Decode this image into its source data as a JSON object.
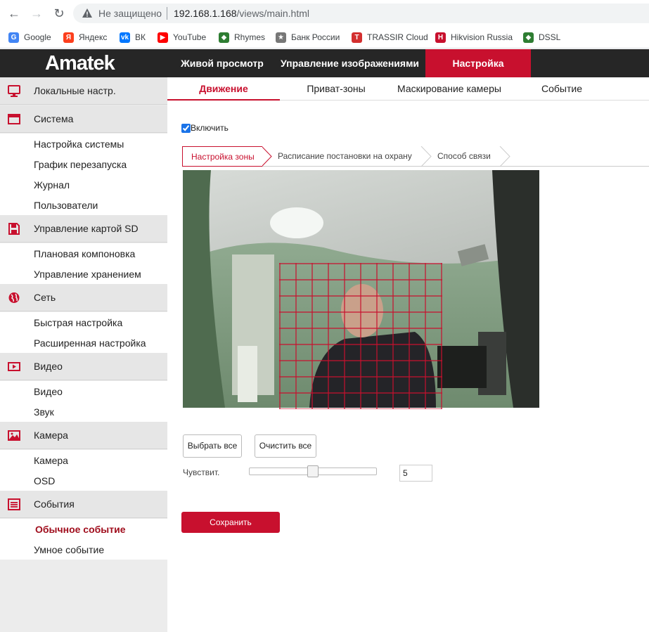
{
  "browser": {
    "security_label": "Не защищено",
    "url_host": "192.168.1.168",
    "url_path": "/views/main.html",
    "bookmarks": [
      {
        "label": "Google",
        "icon": "google-icon",
        "color": "#4285f4"
      },
      {
        "label": "Яндекс",
        "icon": "yandex-icon",
        "color": "#fc3f1d"
      },
      {
        "label": "ВК",
        "icon": "vk-icon",
        "color": "#0077ff"
      },
      {
        "label": "YouTube",
        "icon": "youtube-icon",
        "color": "#ff0000"
      },
      {
        "label": "Rhymes",
        "icon": "rhymes-icon",
        "color": "#2e7d32"
      },
      {
        "label": "Банк России",
        "icon": "bank-russia-icon",
        "color": "#777777"
      },
      {
        "label": "TRASSIR Cloud",
        "icon": "trassir-icon",
        "color": "#d32f2f"
      },
      {
        "label": "Hikvision Russia",
        "icon": "hikvision-icon",
        "color": "#c8102e"
      },
      {
        "label": "DSSL",
        "icon": "dssl-icon",
        "color": "#2e7d32"
      }
    ]
  },
  "app": {
    "logo": "Amatek",
    "top_nav": [
      "Живой просмотр",
      "Управление изображениями",
      "Настройка"
    ],
    "active_top_nav": "Настройка",
    "accent": "#c8102e"
  },
  "sidebar": {
    "sections": [
      {
        "label": "Локальные настр.",
        "icon": "monitor-icon",
        "items": []
      },
      {
        "label": "Система",
        "icon": "window-icon",
        "items": [
          "Настройка системы",
          "График перезапуска",
          "Журнал",
          "Пользователи"
        ]
      },
      {
        "label": "Управление картой SD",
        "icon": "sd-card-icon",
        "items": [
          "Плановая компоновка",
          "Управление хранением"
        ]
      },
      {
        "label": "Сеть",
        "icon": "globe-icon",
        "items": [
          "Быстрая настройка",
          "Расширенная настройка"
        ]
      },
      {
        "label": "Видео",
        "icon": "video-icon",
        "items": [
          "Видео",
          "Звук"
        ]
      },
      {
        "label": "Камера",
        "icon": "image-icon",
        "items": [
          "Камера",
          "OSD"
        ]
      },
      {
        "label": "События",
        "icon": "events-icon",
        "items": [
          "Обычное событие",
          "Умное событие"
        ]
      }
    ],
    "active_item": "Обычное событие"
  },
  "tabs": [
    "Движение",
    "Приват-зоны",
    "Маскирование камеры",
    "Событие"
  ],
  "active_tab": "Движение",
  "enable": {
    "label": "Включить",
    "checked": true
  },
  "steps": [
    "Настройка зоны",
    "Расписание постановки на охрану",
    "Способ связи"
  ],
  "active_step": "Настройка зоны",
  "buttons": {
    "select_all": "Выбрать все",
    "clear_all": "Очистить все",
    "save": "Сохранить"
  },
  "sensitivity": {
    "label": "Чувствит.",
    "value": "5",
    "slider_fraction": 0.5
  }
}
